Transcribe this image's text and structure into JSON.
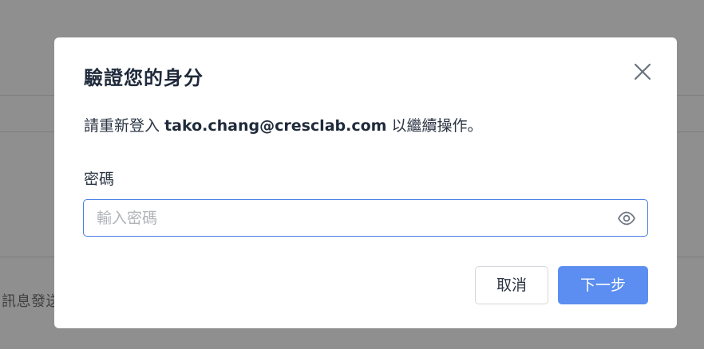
{
  "background": {
    "partial_text": "訊息發送"
  },
  "dialog": {
    "title": "驗證您的身分",
    "description_prefix": "請重新登入 ",
    "email": "tako.chang@cresclab.com",
    "description_suffix": " 以繼續操作。",
    "password_label": "密碼",
    "password_placeholder": "輸入密碼",
    "password_value": "",
    "cancel_label": "取消",
    "next_label": "下一步",
    "close_icon": "close-icon",
    "eye_icon": "eye-icon"
  },
  "colors": {
    "overlay": "#8f8f8f",
    "accent": "#5b8ef0",
    "focus_border": "#4a7de4",
    "title_text": "#1f2a3a"
  }
}
